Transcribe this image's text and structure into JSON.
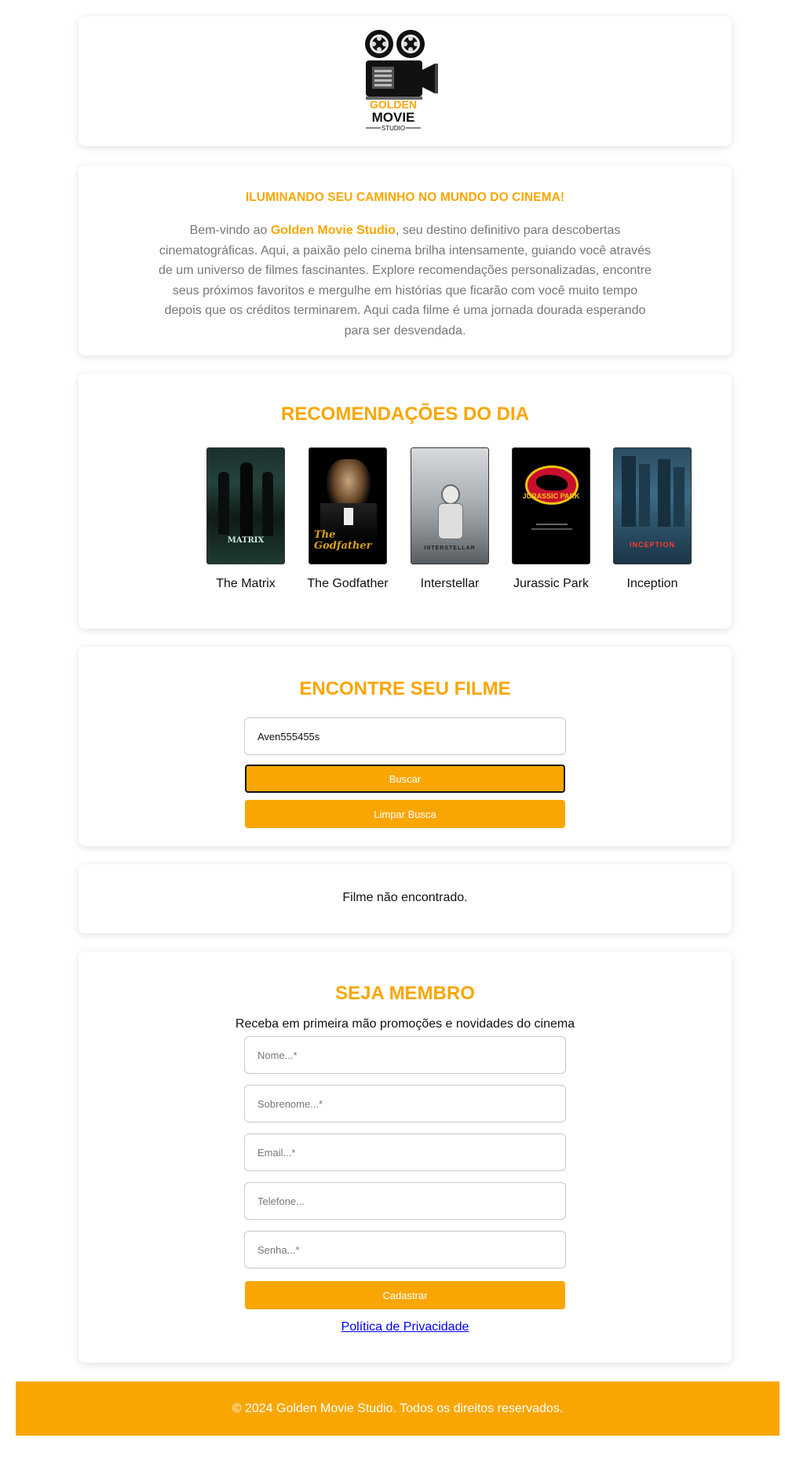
{
  "logo": {
    "line1": "GOLDEN",
    "line2": "MOVIE",
    "line3": "STUDIO"
  },
  "intro": {
    "heading": "ILUMINANDO SEU CAMINHO NO MUNDO DO CINEMA!",
    "text_before": "Bem-vindo ao ",
    "brand": "Golden Movie Studio",
    "text_after": ", seu destino definitivo para descobertas cinematográficas. Aqui, a paixão pelo cinema brilha intensamente, guiando você através de um universo de filmes fascinantes. Explore recomendações personalizadas, encontre seus próximos favoritos e mergulhe em histórias que ficarão com você muito tempo depois que os créditos terminarem. Aqui cada filme é uma jornada dourada esperando para ser desvendada."
  },
  "recommendations": {
    "title": "RECOMENDAÇÕES DO DIA",
    "movies": [
      {
        "title": "The Matrix",
        "poster_text": "MATRIX"
      },
      {
        "title": "The Godfather",
        "poster_text": "The Godfather"
      },
      {
        "title": "Interstellar",
        "poster_text": "INTERSTELLAR"
      },
      {
        "title": "Jurassic Park",
        "poster_text": "JURASSIC PARK"
      },
      {
        "title": "Inception",
        "poster_text": "INCEPTION"
      }
    ]
  },
  "search": {
    "title": "ENCONTRE SEU FILME",
    "input_value": "Aven555455s",
    "search_button": "Buscar",
    "clear_button": "Limpar Busca"
  },
  "result": {
    "message": "Filme não encontrado."
  },
  "membership": {
    "title": "SEJA MEMBRO",
    "subtitle": "Receba em primeira mão promoções e novidades do cinema",
    "fields": {
      "first_name": "Nome...*",
      "last_name": "Sobrenome...*",
      "email": "Email...*",
      "phone": "Telefone...",
      "password": "Senha...*"
    },
    "submit_button": "Cadastrar",
    "privacy_link": "Política de Privacidade"
  },
  "footer": {
    "text": "© 2024 Golden Movie Studio. Todos os direitos reservados."
  },
  "colors": {
    "accent": "#f9a602",
    "text_muted": "#777777",
    "link": "#0000ee"
  }
}
